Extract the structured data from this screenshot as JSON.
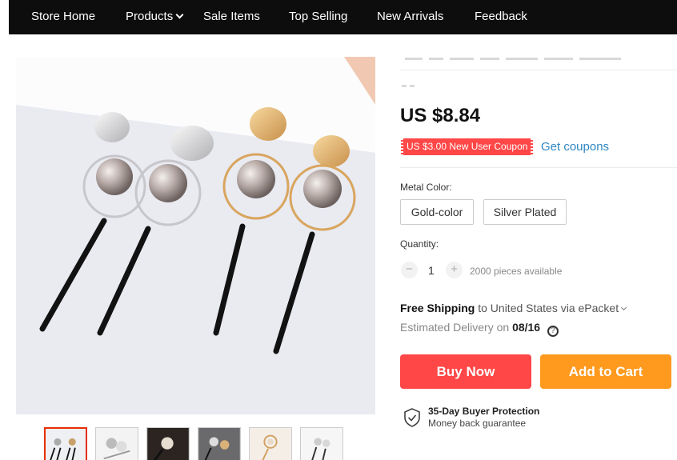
{
  "nav": {
    "items": [
      "Store Home",
      "Products",
      "Sale Items",
      "Top Selling",
      "New Arrivals",
      "Feedback"
    ]
  },
  "product": {
    "price": "US $8.84",
    "coupon_badge": "US $3.00 New User Coupon",
    "get_coupons": "Get coupons",
    "metal_color_label": "Metal Color:",
    "colors": [
      "Gold-color",
      "Silver Plated"
    ],
    "quantity_label": "Quantity:",
    "quantity_value": "1",
    "qty_minus": "−",
    "qty_plus": "+",
    "available": "2000 pieces available",
    "shipping_bold": "Free Shipping",
    "shipping_rest": "to United States via ePacket",
    "delivery_prefix": "Estimated Delivery on",
    "delivery_date": "08/16",
    "help_glyph": "?"
  },
  "actions": {
    "buy_now": "Buy Now",
    "add_to_cart": "Add to Cart"
  },
  "protection": {
    "title": "35-Day Buyer Protection",
    "subtitle": "Money back guarantee"
  },
  "colors": {
    "nav_bg": "#0d0d0d",
    "buy_now": "#ff4747",
    "add_to_cart": "#ff9a1f",
    "link": "#2e86c1",
    "coupon": "#ff4747"
  },
  "icons": [
    "chevron-down-icon",
    "help-icon",
    "shield-check-icon",
    "minus-icon",
    "plus-icon"
  ]
}
